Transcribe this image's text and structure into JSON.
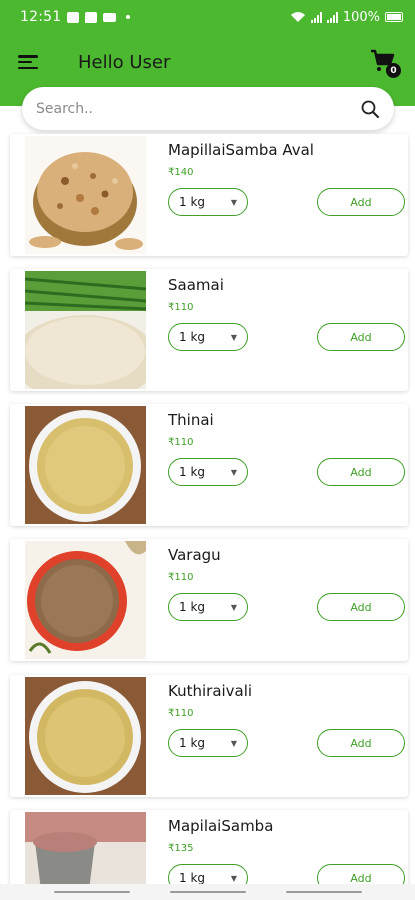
{
  "status_bar": {
    "time": "12:51",
    "battery": "100%"
  },
  "app_bar": {
    "title": "Hello User",
    "cart_count": "0"
  },
  "search": {
    "placeholder": "Search.."
  },
  "colors": {
    "primary": "#4cb82f",
    "accent": "#3f9f27"
  },
  "products": [
    {
      "name": "MapillaiSamba Aval",
      "price": "₹140",
      "qty": "1 kg",
      "add_label": "Add",
      "image": "flattened-rice-bowl"
    },
    {
      "name": "Saamai",
      "price": "₹110",
      "qty": "1 kg",
      "add_label": "Add",
      "image": "millet-pile-with-grass"
    },
    {
      "name": "Thinai",
      "price": "₹110",
      "qty": "1 kg",
      "add_label": "Add",
      "image": "millet-bowl"
    },
    {
      "name": "Varagu",
      "price": "₹110",
      "qty": "1 kg",
      "add_label": "Add",
      "image": "millet-red-bowl"
    },
    {
      "name": "Kuthiraivali",
      "price": "₹110",
      "qty": "1 kg",
      "add_label": "Add",
      "image": "millet-bowl"
    },
    {
      "name": "MapilaiSamba",
      "price": "₹135",
      "qty": "1 kg",
      "add_label": "Add",
      "image": "red-rice-stone-bowl"
    }
  ]
}
